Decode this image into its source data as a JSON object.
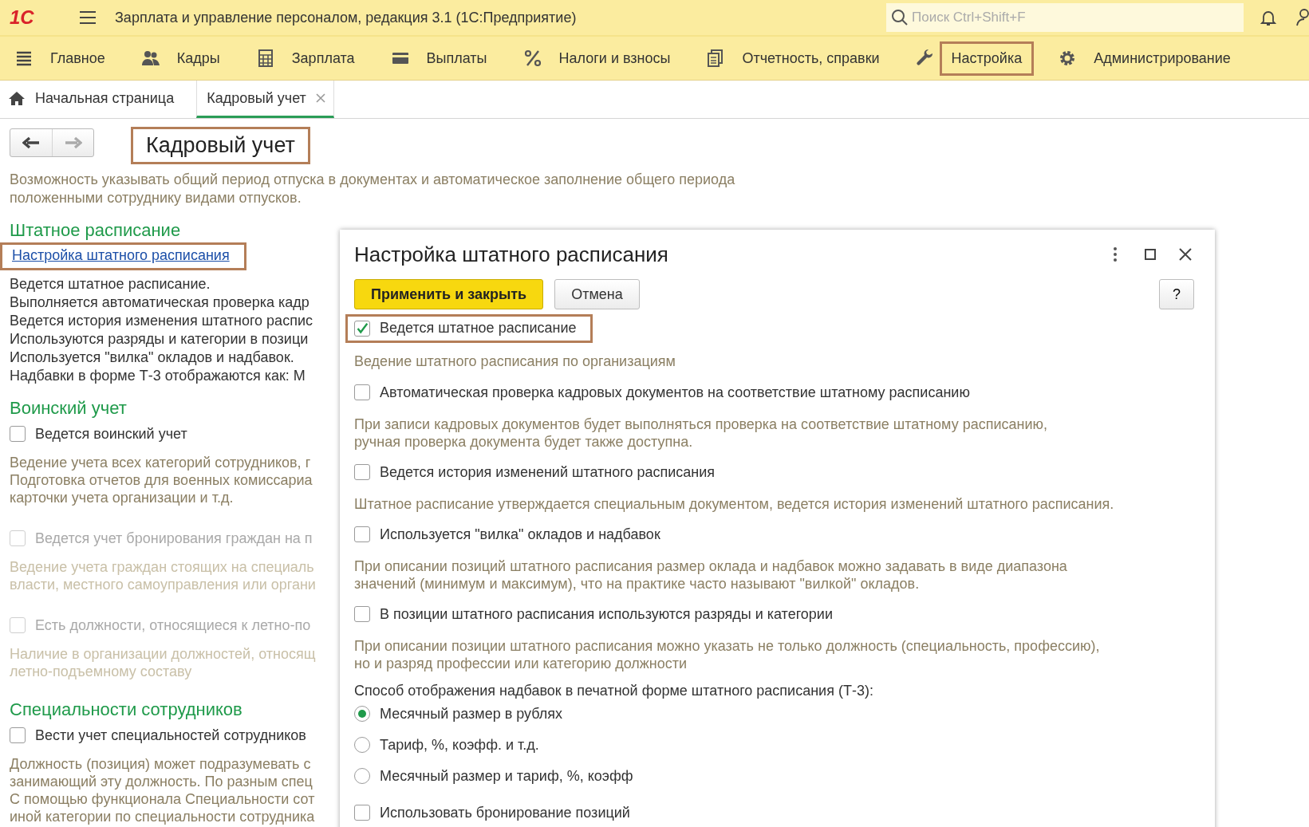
{
  "app": {
    "logo": "1С",
    "title": "Зарплата и управление персоналом, редакция 3.1  (1С:Предприятие)",
    "search": {
      "placeholder": "Поиск Ctrl+Shift+F"
    }
  },
  "sections": [
    {
      "label": "Главное",
      "highlighted": false
    },
    {
      "label": "Кадры",
      "highlighted": false
    },
    {
      "label": "Зарплата",
      "highlighted": false
    },
    {
      "label": "Выплаты",
      "highlighted": false
    },
    {
      "label": "Налоги и взносы",
      "highlighted": false
    },
    {
      "label": "Отчетность, справки",
      "highlighted": false
    },
    {
      "label": "Настройка",
      "highlighted": true
    },
    {
      "label": "Администрирование",
      "highlighted": false
    }
  ],
  "tabs": [
    {
      "label": "Начальная страница",
      "kind": "home",
      "selected": false
    },
    {
      "label": "Кадровый учет",
      "kind": "closable",
      "selected": true
    }
  ],
  "page": {
    "back_disabled": false,
    "forward_disabled": true,
    "title": "Кадровый учет",
    "title_highlighted": true,
    "intro": [
      "Возможность указывать общий период отпуска в документах и автоматическое заполнение общего периода",
      "положенными сотруднику видами отпусков."
    ],
    "blocks": [
      {
        "kind": "heading",
        "text": "Штатное расписание"
      },
      {
        "kind": "link",
        "text": "Настройка штатного расписания",
        "highlighted": true
      },
      {
        "kind": "summary",
        "lines": [
          "Ведется штатное расписание.",
          "Выполняется автоматическая проверка кадр",
          "Ведется история изменения штатного распис",
          "Используются разряды и категории в позици",
          "Используется \"вилка\" окладов и надбавок.",
          "Надбавки в форме Т-3 отображаются как: М"
        ]
      },
      {
        "kind": "heading",
        "text": "Воинский учет"
      },
      {
        "kind": "checkbox",
        "label": "Ведется воинский учет",
        "checked": false,
        "disabled": false
      },
      {
        "kind": "note",
        "lines": [
          "Ведение учета всех категорий сотрудников, г",
          "Подготовка отчетов для военных комиссариа",
          "карточки учета организации и т.д."
        ],
        "disabled": false
      },
      {
        "kind": "checkbox",
        "label": "Ведется учет бронирования граждан на п",
        "checked": false,
        "disabled": true
      },
      {
        "kind": "note",
        "lines": [
          "Ведение учета граждан стоящих на специаль",
          "власти, местного самоуправления или органи"
        ],
        "disabled": true
      },
      {
        "kind": "checkbox",
        "label": "Есть должности, относящиеся к летно-по",
        "checked": false,
        "disabled": true
      },
      {
        "kind": "note",
        "lines": [
          "Наличие в организации должностей, относящ",
          "летно-подъемному составу"
        ],
        "disabled": true
      },
      {
        "kind": "heading",
        "text": "Специальности сотрудников"
      },
      {
        "kind": "checkbox",
        "label": "Вести учет специальностей сотрудников",
        "checked": false,
        "disabled": false
      },
      {
        "kind": "note",
        "lines": [
          "Должность (позиция) может подразумевать с",
          "занимающий эту должность. По разным спец",
          "С помощью функционала Специальности сот",
          "иной категории по специальности сотрудника"
        ],
        "disabled": false
      }
    ]
  },
  "dialog": {
    "title": "Настройка штатного расписания",
    "buttons": [
      {
        "label": "Применить и закрыть",
        "kind": "primary"
      },
      {
        "label": "Отмена",
        "kind": "default"
      }
    ],
    "help": "?",
    "items": [
      {
        "kind": "checkbox",
        "label": "Ведется штатное расписание",
        "checked": true,
        "highlighted": true
      },
      {
        "kind": "label",
        "text": "Ведение штатного расписания по организациям"
      },
      {
        "kind": "checkbox",
        "label": "Автоматическая проверка кадровых документов на соответствие штатному расписанию",
        "checked": false,
        "highlighted": false
      },
      {
        "kind": "note",
        "lines": [
          "При записи кадровых документов будет выполняться проверка на соответствие штатному расписанию,",
          "ручная проверка документа будет также доступна."
        ]
      },
      {
        "kind": "checkbox",
        "label": "Ведется история изменений штатного расписания",
        "checked": false,
        "highlighted": false
      },
      {
        "kind": "note",
        "lines": [
          "Штатное расписание утверждается специальным документом, ведется история изменений штатного расписания."
        ]
      },
      {
        "kind": "checkbox",
        "label": "Используется \"вилка\" окладов и надбавок",
        "checked": false,
        "highlighted": false
      },
      {
        "kind": "note",
        "lines": [
          "При описании позиций штатного расписания размер оклада и надбавок можно задавать в виде диапазона",
          "значений (минимум и максимум), что на практике часто называют \"вилкой\" окладов."
        ]
      },
      {
        "kind": "checkbox",
        "label": "В позиции штатного расписания используются разряды и категории",
        "checked": false,
        "highlighted": false
      },
      {
        "kind": "note",
        "lines": [
          "При описании позиции штатного расписания можно указать не только должность (специальность, профессию),",
          "но и разряд профессии или категорию должности"
        ]
      },
      {
        "kind": "caption",
        "text": "Способ отображения надбавок в печатной форме штатного расписания (Т-3):"
      },
      {
        "kind": "radio",
        "label": "Месячный размер в рублях",
        "selected": true
      },
      {
        "kind": "radio",
        "label": "Тариф, %, коэфф. и т.д.",
        "selected": false
      },
      {
        "kind": "radio",
        "label": "Месячный размер и тариф, %, коэфф",
        "selected": false
      },
      {
        "kind": "checkbox",
        "label": "Использовать бронирование позиций",
        "checked": false,
        "highlighted": false
      }
    ]
  }
}
